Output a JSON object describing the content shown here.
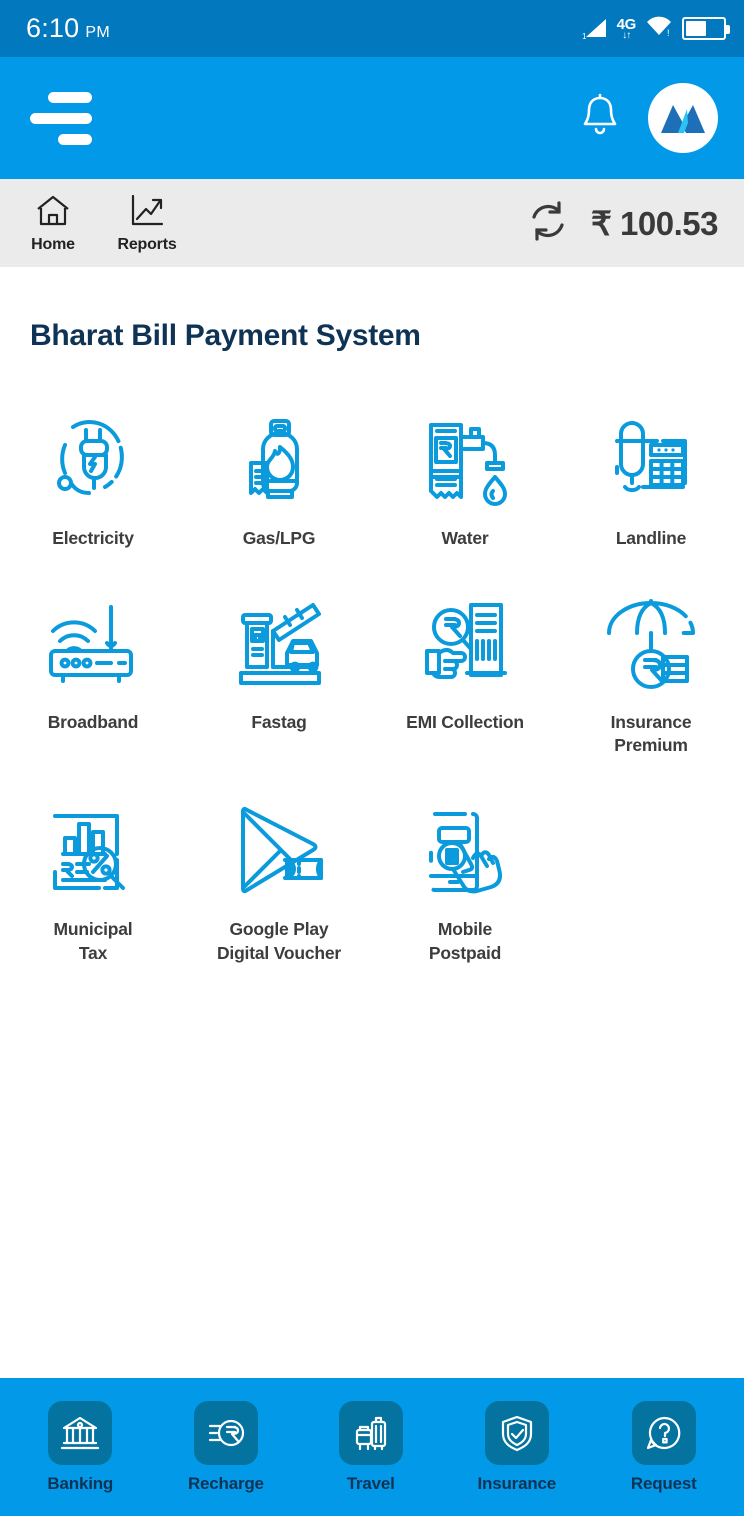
{
  "status_bar": {
    "time": "6:10",
    "ampm": "PM",
    "network": "4G",
    "network_arrows": "↓↑",
    "signal_icon": "cellular-signal-icon",
    "wifi_icon": "wifi-icon",
    "battery_icon": "battery-icon",
    "battery_level_percent": 55,
    "background_color": "#0279bf"
  },
  "app_bar": {
    "menu_icon": "hamburger-menu-icon",
    "notification_icon": "bell-icon",
    "logo_icon": "app-logo-icon",
    "background_color": "#029ae8"
  },
  "sub_nav": {
    "items": [
      {
        "label": "Home",
        "icon": "home-icon"
      },
      {
        "label": "Reports",
        "icon": "chart-trend-icon"
      }
    ],
    "refresh_icon": "refresh-icon",
    "balance": "₹ 100.53",
    "background_color": "#ebebeb"
  },
  "main": {
    "title": "Bharat Bill Payment System",
    "title_color": "#0f3354",
    "icon_color": "#0b9bdd",
    "services": [
      {
        "label": "Electricity",
        "icon": "electricity-plug-icon"
      },
      {
        "label": "Gas/LPG",
        "icon": "gas-cylinder-icon"
      },
      {
        "label": "Water",
        "icon": "water-tap-icon"
      },
      {
        "label": "Landline",
        "icon": "landline-phone-icon"
      },
      {
        "label": "Broadband",
        "icon": "wifi-router-icon"
      },
      {
        "label": "Fastag",
        "icon": "toll-barrier-icon"
      },
      {
        "label": "EMI Collection",
        "icon": "emi-document-icon"
      },
      {
        "label": "Insurance\nPremium",
        "icon": "umbrella-coins-icon"
      },
      {
        "label": "Municipal\nTax",
        "icon": "tax-document-icon"
      },
      {
        "label": "Google Play\nDigital Voucher",
        "icon": "google-play-voucher-icon"
      },
      {
        "label": "Mobile\nPostpaid",
        "icon": "mobile-postpaid-icon"
      }
    ]
  },
  "bottom_bar": {
    "background_color": "#029ae8",
    "tile_color": "#04739f",
    "label_color": "#0f3354",
    "items": [
      {
        "label": "Banking",
        "icon": "bank-icon"
      },
      {
        "label": "Recharge",
        "icon": "rupee-recharge-icon"
      },
      {
        "label": "Travel",
        "icon": "luggage-icon"
      },
      {
        "label": "Insurance",
        "icon": "shield-check-icon"
      },
      {
        "label": "Request",
        "icon": "question-bubble-icon"
      }
    ]
  }
}
